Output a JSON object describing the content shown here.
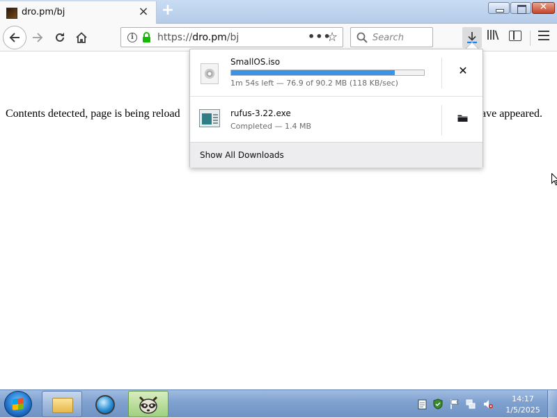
{
  "browser": {
    "tab": {
      "title": "dro.pm/bj"
    },
    "url": {
      "prefix": "https://",
      "host": "dro.pm",
      "path": "/bj"
    },
    "search": {
      "placeholder": "Search"
    }
  },
  "page": {
    "text_left": "Contents detected, page is being reload",
    "text_right": "have appeared."
  },
  "downloads": {
    "items": [
      {
        "name": "SmallOS.iso",
        "status": "1m 54s left — 76.9 of 90.2 MB (118 KB/sec)",
        "progress": 0.85,
        "icon": "iso-file-icon",
        "action": "cancel"
      },
      {
        "name": "rufus-3.22.exe",
        "status": "Completed — 1.4 MB",
        "icon": "exe-file-icon",
        "action": "open-folder"
      }
    ],
    "footer_label": "Show All Downloads",
    "cancel_glyph": "✕"
  },
  "taskbar": {
    "pinned": [
      "folder-icon",
      "globe-icon",
      "raccoon-icon"
    ],
    "clock": {
      "time": "14:17",
      "date": "1/5/2025"
    }
  },
  "colors": {
    "accent": "#3a93e6",
    "lock_green": "#12bc00"
  }
}
